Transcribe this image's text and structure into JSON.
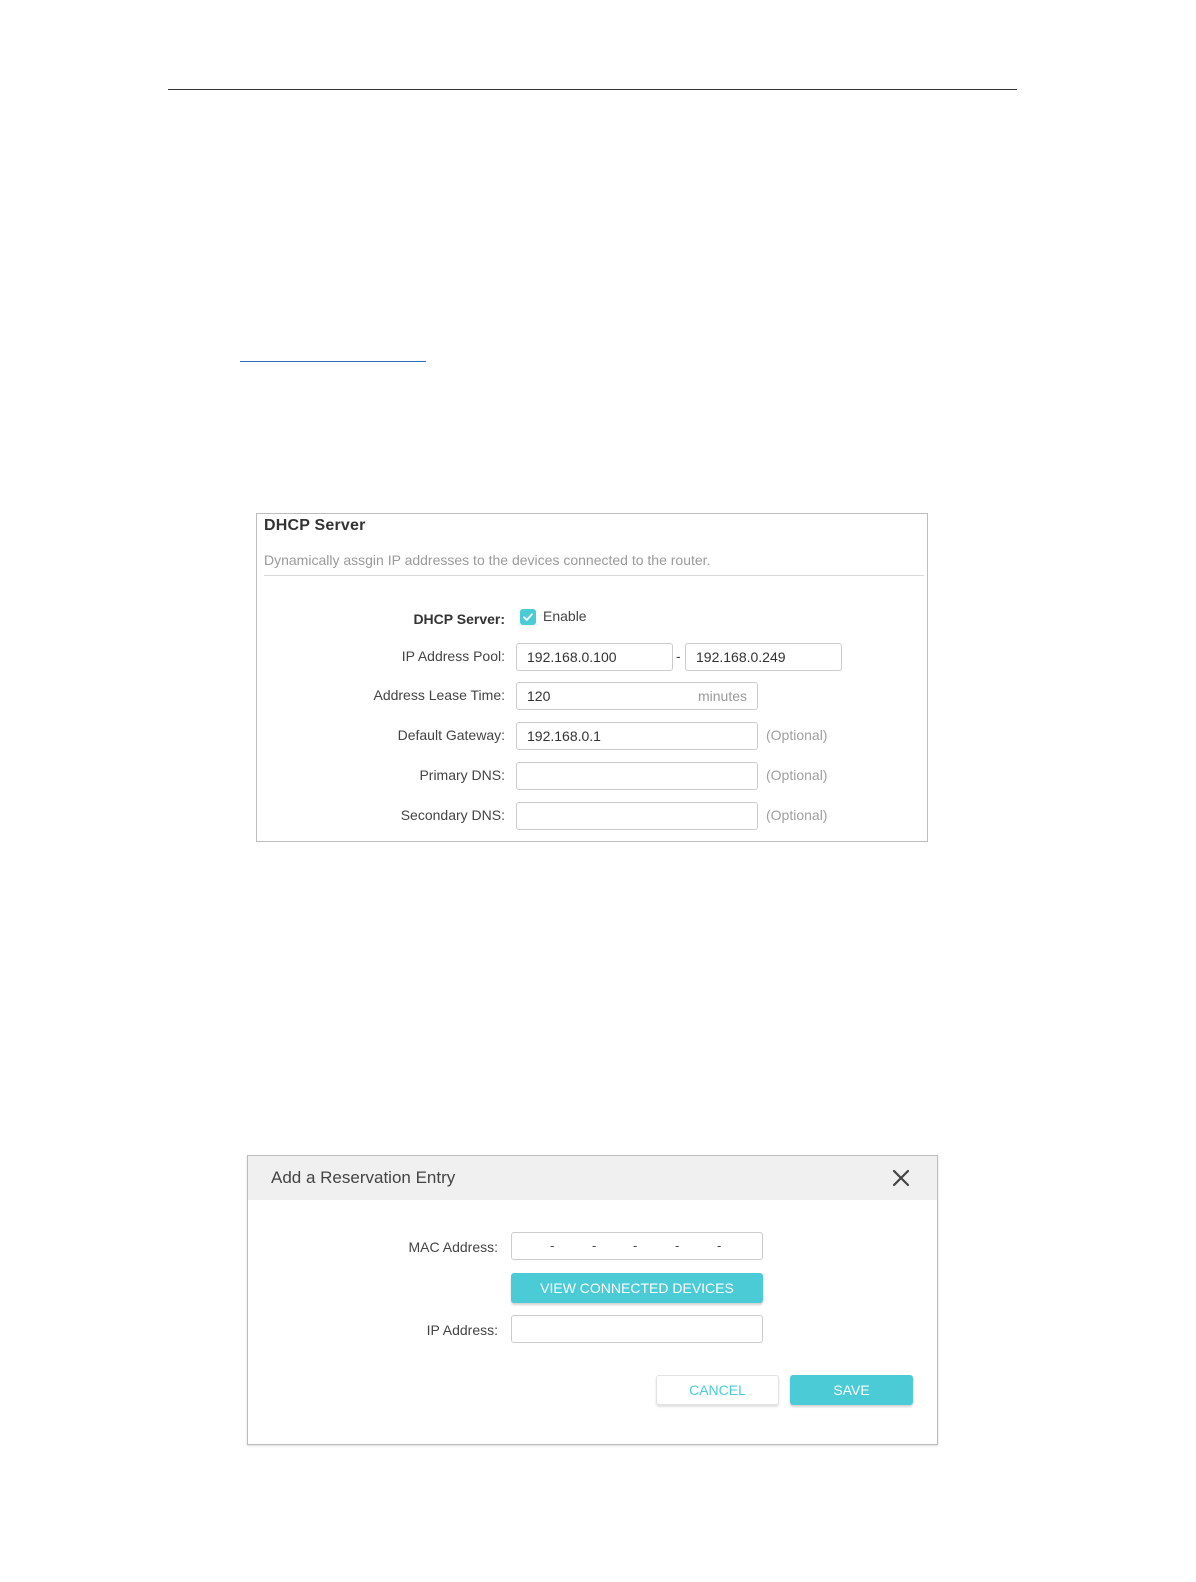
{
  "dhcp": {
    "title": "DHCP Server",
    "description": "Dynamically assgin IP addresses to the devices connected to the router.",
    "server_label": "DHCP Server:",
    "enable_label": "Enable",
    "enabled": true,
    "pool_label": "IP Address Pool:",
    "pool_start": "192.168.0.100",
    "pool_separator": "-",
    "pool_end": "192.168.0.249",
    "lease_label": "Address Lease Time:",
    "lease_value": "120",
    "lease_unit": "minutes",
    "gateway_label": "Default Gateway:",
    "gateway_value": "192.168.0.1",
    "gateway_hint": "(Optional)",
    "primary_dns_label": "Primary DNS:",
    "primary_dns_value": "",
    "primary_dns_hint": "(Optional)",
    "secondary_dns_label": "Secondary DNS:",
    "secondary_dns_value": "",
    "secondary_dns_hint": "(Optional)"
  },
  "reservation": {
    "title": "Add a Reservation Entry",
    "mac_label": "MAC Address:",
    "mac_separators": [
      "-",
      "-",
      "-",
      "-",
      "-"
    ],
    "view_devices_label": "VIEW CONNECTED DEVICES",
    "ip_label": "IP Address:",
    "ip_value": "",
    "cancel_label": "CANCEL",
    "save_label": "SAVE"
  },
  "colors": {
    "accent": "#4acbd6",
    "border": "#cccccc",
    "hint_text": "#a0a0a0",
    "header_bg": "#f0f0f0"
  }
}
